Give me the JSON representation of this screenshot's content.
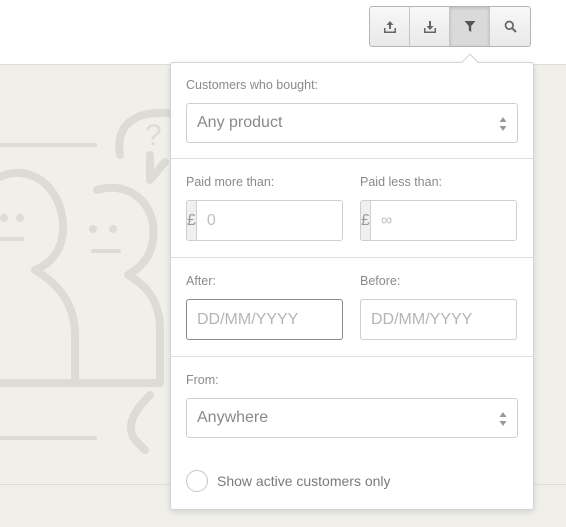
{
  "toolbar": {
    "buttons": [
      {
        "icon": "upload-icon",
        "active": false
      },
      {
        "icon": "download-icon",
        "active": false
      },
      {
        "icon": "filter-icon",
        "active": true
      },
      {
        "icon": "search-icon",
        "active": false
      }
    ]
  },
  "filter": {
    "bought_label": "Customers who bought:",
    "bought_value": "Any product",
    "paid_more_label": "Paid more than:",
    "paid_less_label": "Paid less than:",
    "currency": "£",
    "paid_more_placeholder": "0",
    "paid_less_placeholder": "∞",
    "after_label": "After:",
    "before_label": "Before:",
    "date_placeholder": "DD/MM/YYYY",
    "from_label": "From:",
    "from_value": "Anywhere",
    "active_only_label": "Show active customers only"
  },
  "colors": {
    "background": "#f0efea",
    "illustration": "#dcdbd5",
    "popover": "#ffffff"
  }
}
